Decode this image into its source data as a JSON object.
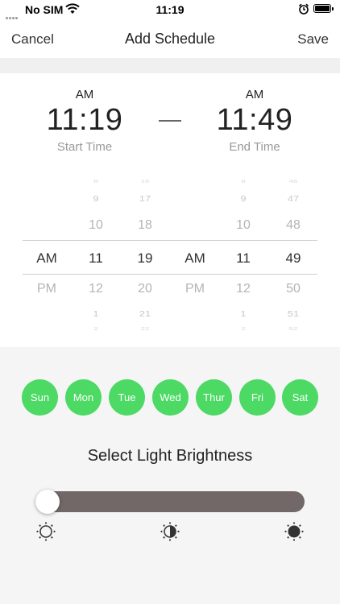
{
  "status_bar": {
    "carrier": "No SIM",
    "time": "11:19",
    "icons": [
      "signal-dots-icon",
      "wifi-icon",
      "alarm-icon",
      "battery-icon"
    ]
  },
  "nav": {
    "cancel_label": "Cancel",
    "title": "Add Schedule",
    "save_label": "Save"
  },
  "start": {
    "ampm": "AM",
    "time": "11:19",
    "label": "Start Time"
  },
  "end": {
    "ampm": "AM",
    "time": "11:49",
    "label": "End Time"
  },
  "picker": {
    "start_ampm": [
      "AM",
      "PM"
    ],
    "start_hours": [
      "8",
      "9",
      "10",
      "11",
      "12",
      "1",
      "2"
    ],
    "start_minutes": [
      "16",
      "17",
      "18",
      "19",
      "20",
      "21",
      "22"
    ],
    "end_ampm": [
      "AM",
      "PM"
    ],
    "end_hours": [
      "8",
      "9",
      "10",
      "11",
      "12",
      "1",
      "2"
    ],
    "end_minutes": [
      "46",
      "47",
      "48",
      "49",
      "50",
      "51",
      "52"
    ]
  },
  "days": [
    "Sun",
    "Mon",
    "Tue",
    "Wed",
    "Thur",
    "Fri",
    "Sat"
  ],
  "brightness": {
    "title": "Select Light Brightness",
    "value": 0,
    "icons": [
      "brightness-low-icon",
      "brightness-half-icon",
      "brightness-high-icon"
    ]
  },
  "colors": {
    "day_active": "#4cd964",
    "slider_track": "#716867",
    "background": "#f5f5f5"
  }
}
